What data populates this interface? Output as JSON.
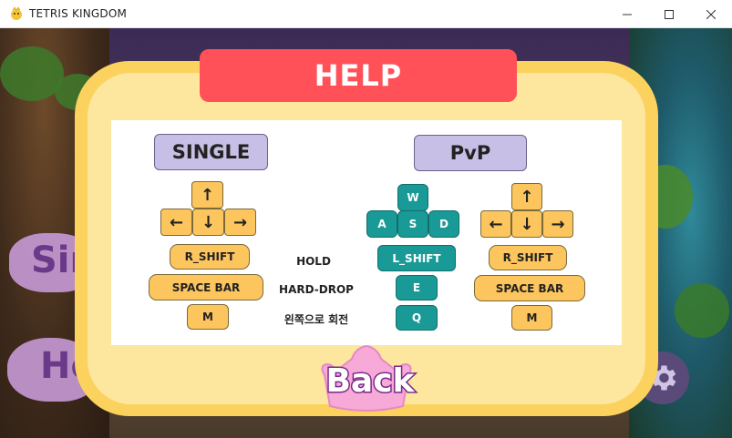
{
  "window": {
    "title": "TETRIS KINGDOM"
  },
  "dialog": {
    "title": "HELP"
  },
  "single": {
    "title": "SINGLE",
    "keys": {
      "up": "↑",
      "left": "←",
      "down": "↓",
      "right": "→",
      "hold": "R_SHIFT",
      "hard_drop": "SPACE BAR",
      "rotate_left": "M"
    }
  },
  "pvp": {
    "title": "PvP",
    "p1_keys": {
      "up": "W",
      "left": "A",
      "down": "S",
      "right": "D",
      "hold": "L_SHIFT",
      "hard_drop": "E",
      "rotate_left": "Q"
    },
    "p2_keys": {
      "up": "↑",
      "left": "←",
      "down": "↓",
      "right": "→",
      "hold": "R_SHIFT",
      "hard_drop": "SPACE BAR",
      "rotate_left": "M"
    }
  },
  "actions": {
    "hold": "HOLD",
    "hard_drop": "HARD-DROP",
    "rotate_left": "왼쪽으로 회전"
  },
  "background": {
    "menu_single_partial": "Sin",
    "menu_help_partial": "He"
  },
  "back_button": {
    "label": "Back"
  },
  "colors": {
    "frame": "#fcd25e",
    "header": "#ff5157",
    "key_yellow": "#fdc55d",
    "key_teal": "#1a9a96",
    "mode_button": "#c7bfe6"
  }
}
